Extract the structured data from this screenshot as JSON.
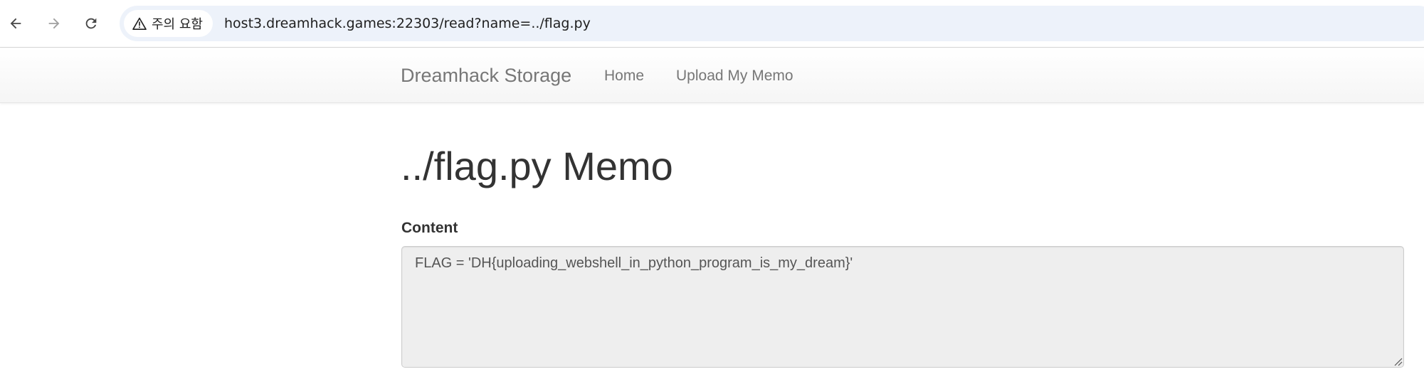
{
  "browser": {
    "security_label": "주의 요함",
    "url": "host3.dreamhack.games:22303/read?name=../flag.py",
    "icons": {
      "back": "arrow-left-icon",
      "forward": "arrow-right-icon",
      "reload": "reload-icon",
      "warning": "warning-triangle-icon"
    }
  },
  "navbar": {
    "brand": "Dreamhack Storage",
    "links": [
      {
        "label": "Home"
      },
      {
        "label": "Upload My Memo"
      }
    ]
  },
  "memo": {
    "title": "../flag.py Memo",
    "content_label": "Content",
    "content_value": "FLAG = 'DH{uploading_webshell_in_python_program_is_my_dream}'"
  },
  "colors": {
    "omnibox_bg": "#edf2fa",
    "navbar_text": "#777777",
    "body_text": "#333333",
    "textarea_bg": "#eeeeee"
  }
}
